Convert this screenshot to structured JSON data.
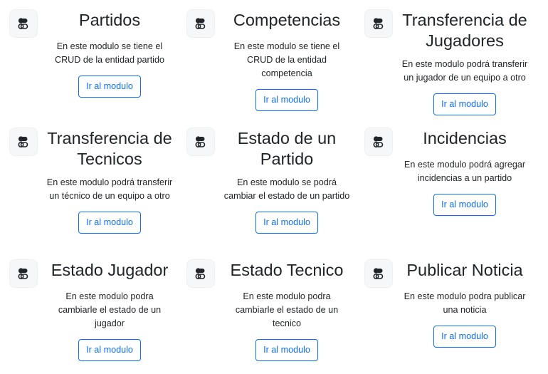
{
  "modules": [
    {
      "title": "Partidos",
      "description": "En este modulo se tiene el CRUD de la entidad partido",
      "button_label": "Ir al modulo",
      "icon": "toggles-icon"
    },
    {
      "title": "Competencias",
      "description": "En este modulo se tiene el CRUD de la entidad competencia",
      "button_label": "Ir al modulo",
      "icon": "toggles-icon"
    },
    {
      "title": "Transferencia de Jugadores",
      "description": "En este modulo podrá transferir un jugador de un equipo a otro",
      "button_label": "Ir al modulo",
      "icon": "toggles-icon"
    },
    {
      "title": "Transferencia de Tecnicos",
      "description": "En este modulo podrá transferir un técnico de un equipo a otro",
      "button_label": "Ir al modulo",
      "icon": "toggles-icon"
    },
    {
      "title": "Estado de un Partido",
      "description": "En este modulo se podrá cambiar el estado de un partido",
      "button_label": "Ir al modulo",
      "icon": "toggles-icon"
    },
    {
      "title": "Incidencias",
      "description": "En este modulo podrá agregar incidencias a un partido",
      "button_label": "Ir al modulo",
      "icon": "toggles-icon"
    },
    {
      "title": "Estado Jugador",
      "description": "En este modulo podra cambiarle el estado de un jugador",
      "button_label": "Ir al modulo",
      "icon": "toggles-icon"
    },
    {
      "title": "Estado Tecnico",
      "description": "En este modulo podra cambiarle el estado de un tecnico",
      "button_label": "Ir al modulo",
      "icon": "toggles-icon"
    },
    {
      "title": "Publicar Noticia",
      "description": "En este modulo podra publicar una noticia",
      "button_label": "Ir al modulo",
      "icon": "toggles-icon"
    }
  ],
  "colors": {
    "primary": "#0d6efd",
    "text": "#212529",
    "icon_bg": "#f6f7f8"
  }
}
